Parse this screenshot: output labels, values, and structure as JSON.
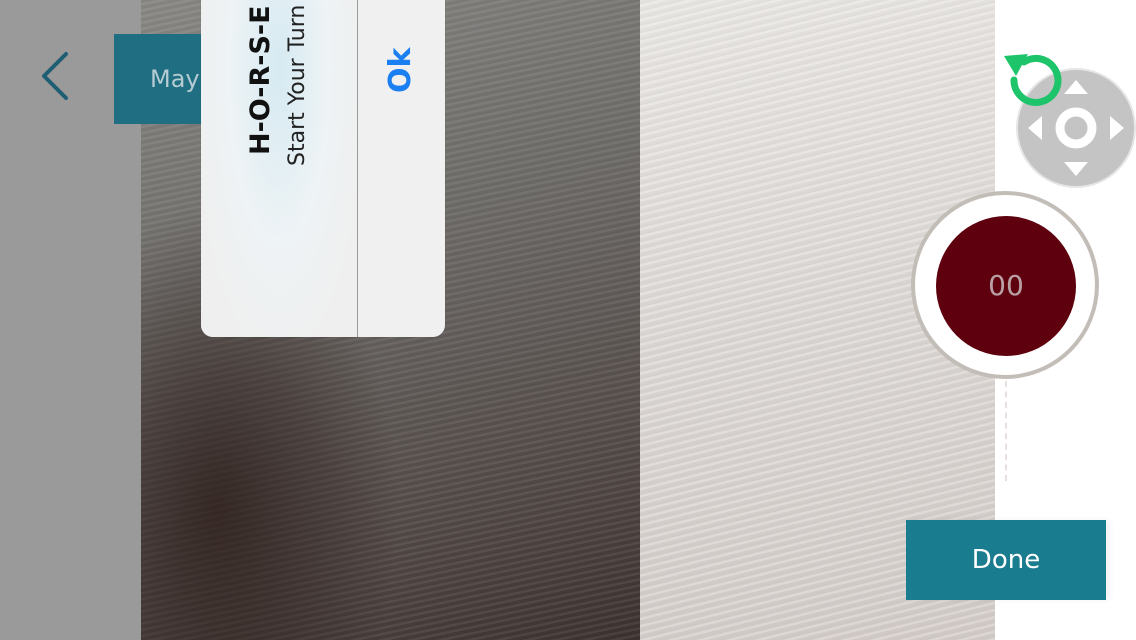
{
  "header": {
    "name_banner": "May"
  },
  "alert": {
    "title": "H-O-R-S-E",
    "message": "Start Your Turn",
    "ok_label": "Ok"
  },
  "timer": {
    "value": "00"
  },
  "done_label": "Done",
  "icons": {
    "back": "chevron-left-icon",
    "undo": "undo-icon",
    "dpad": "dpad-icon"
  },
  "colors": {
    "banner": "#1f6e82",
    "done": "#1a7c8f",
    "record": "#5e000e",
    "undo": "#1ec46a",
    "ok": "#1a7ff0"
  }
}
